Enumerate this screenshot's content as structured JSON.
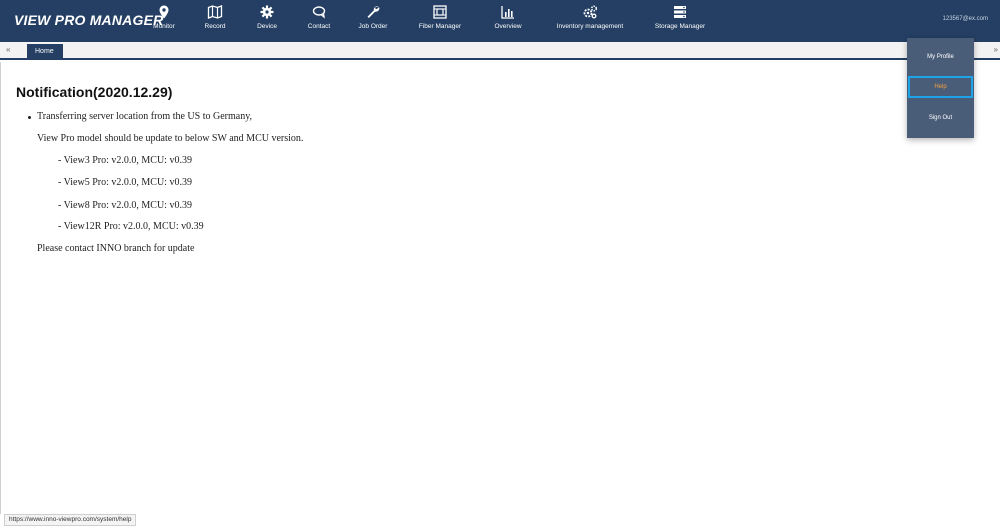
{
  "app": {
    "brand": "VIEW PRO MANAGER"
  },
  "nav": [
    {
      "label": "Monitor",
      "icon": "map-pin-icon"
    },
    {
      "label": "Record",
      "icon": "map-icon"
    },
    {
      "label": "Device",
      "icon": "gear-icon"
    },
    {
      "label": "Contact",
      "icon": "chat-icon"
    },
    {
      "label": "Job Order",
      "icon": "wrench-icon"
    },
    {
      "label": "Fiber Manager",
      "icon": "fiber-icon"
    },
    {
      "label": "Overview",
      "icon": "bar-chart-icon"
    },
    {
      "label": "Inventory management",
      "icon": "gears-icon"
    },
    {
      "label": "Storage Manager",
      "icon": "storage-icon"
    }
  ],
  "user": {
    "email": "123567@ex.com"
  },
  "tabs": {
    "scroll_left": "«",
    "scroll_right": "»",
    "home": "Home"
  },
  "notice": {
    "title": "Notification(2020.12.29)",
    "bullet": "Transferring server location from the US to Germany,",
    "line2": "View Pro model should be update to below SW and MCU version.",
    "versions": [
      "- View3 Pro: v2.0.0, MCU: v0.39",
      "- View5 Pro: v2.0.0, MCU: v0.39",
      "- View8 Pro: v2.0.0, MCU: v0.39",
      "- View12R Pro: v2.0.0, MCU: v0.39"
    ],
    "footer": "Please contact INNO branch for update"
  },
  "dropdown": {
    "my_profile": "My Profile",
    "help": "Help",
    "sign_out": "Sign Out"
  },
  "status_bar": {
    "url": "https://www.inno-viewpro.com/system/help"
  },
  "colors": {
    "header": "#243f63",
    "dropdown": "#4a5d78",
    "highlight": "#1ea3e6",
    "help_text": "#f0a040"
  }
}
